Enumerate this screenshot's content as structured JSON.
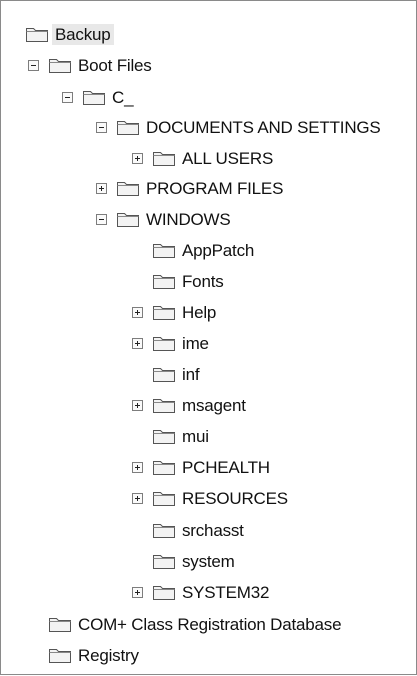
{
  "tree": {
    "backup": "Backup",
    "boot_files": "Boot Files",
    "c_drive": "C_",
    "documents_and_settings": "DOCUMENTS AND SETTINGS",
    "all_users": "ALL USERS",
    "program_files": "PROGRAM FILES",
    "windows": "WINDOWS",
    "apppatch": "AppPatch",
    "fonts": "Fonts",
    "help": "Help",
    "ime": "ime",
    "inf": "inf",
    "msagent": "msagent",
    "mui": "mui",
    "pchealth": "PCHEALTH",
    "resources": "RESOURCES",
    "srchasst": "srchasst",
    "system": "system",
    "system32": "SYSTEM32",
    "com_plus": "COM+ Class Registration Database",
    "registry": "Registry"
  }
}
